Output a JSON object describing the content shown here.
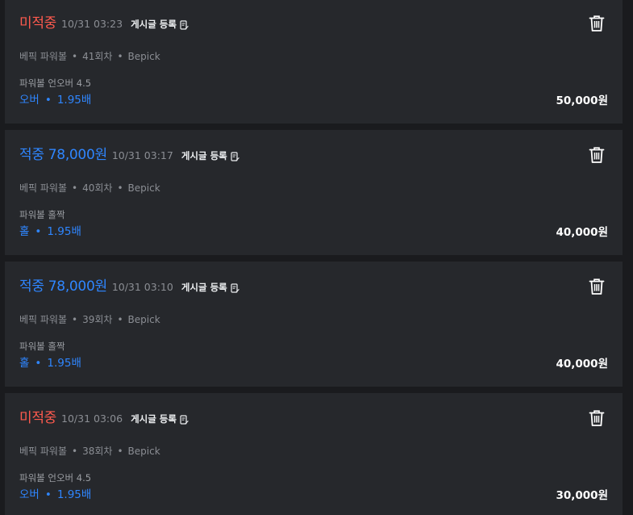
{
  "colors": {
    "page_bg": "#1a1b1e",
    "card_bg": "#26282c",
    "miss_red": "#ff5a4e",
    "hit_blue": "#2f86ff",
    "muted": "#8b8e94"
  },
  "post_label": "게시글 등록",
  "post_icon": "edit-document-icon",
  "delete_icon": "trash-icon",
  "separator": "•",
  "bets": [
    {
      "status": "미적중",
      "status_type": "miss",
      "datetime": "10/31 03:23",
      "game": "베픽 파워볼",
      "round": "41회차",
      "site": "Bepick",
      "market": "파워볼 언오버 4.5",
      "pick": "오버",
      "odds": "1.95배",
      "amount": "50,000원"
    },
    {
      "status": "적중 78,000원",
      "status_type": "hit",
      "datetime": "10/31 03:17",
      "game": "베픽 파워볼",
      "round": "40회차",
      "site": "Bepick",
      "market": "파워볼 홀짝",
      "pick": "홀",
      "odds": "1.95배",
      "amount": "40,000원"
    },
    {
      "status": "적중 78,000원",
      "status_type": "hit",
      "datetime": "10/31 03:10",
      "game": "베픽 파워볼",
      "round": "39회차",
      "site": "Bepick",
      "market": "파워볼 홀짝",
      "pick": "홀",
      "odds": "1.95배",
      "amount": "40,000원"
    },
    {
      "status": "미적중",
      "status_type": "miss",
      "datetime": "10/31 03:06",
      "game": "베픽 파워볼",
      "round": "38회차",
      "site": "Bepick",
      "market": "파워볼 언오버 4.5",
      "pick": "오버",
      "odds": "1.95배",
      "amount": "30,000원"
    }
  ]
}
